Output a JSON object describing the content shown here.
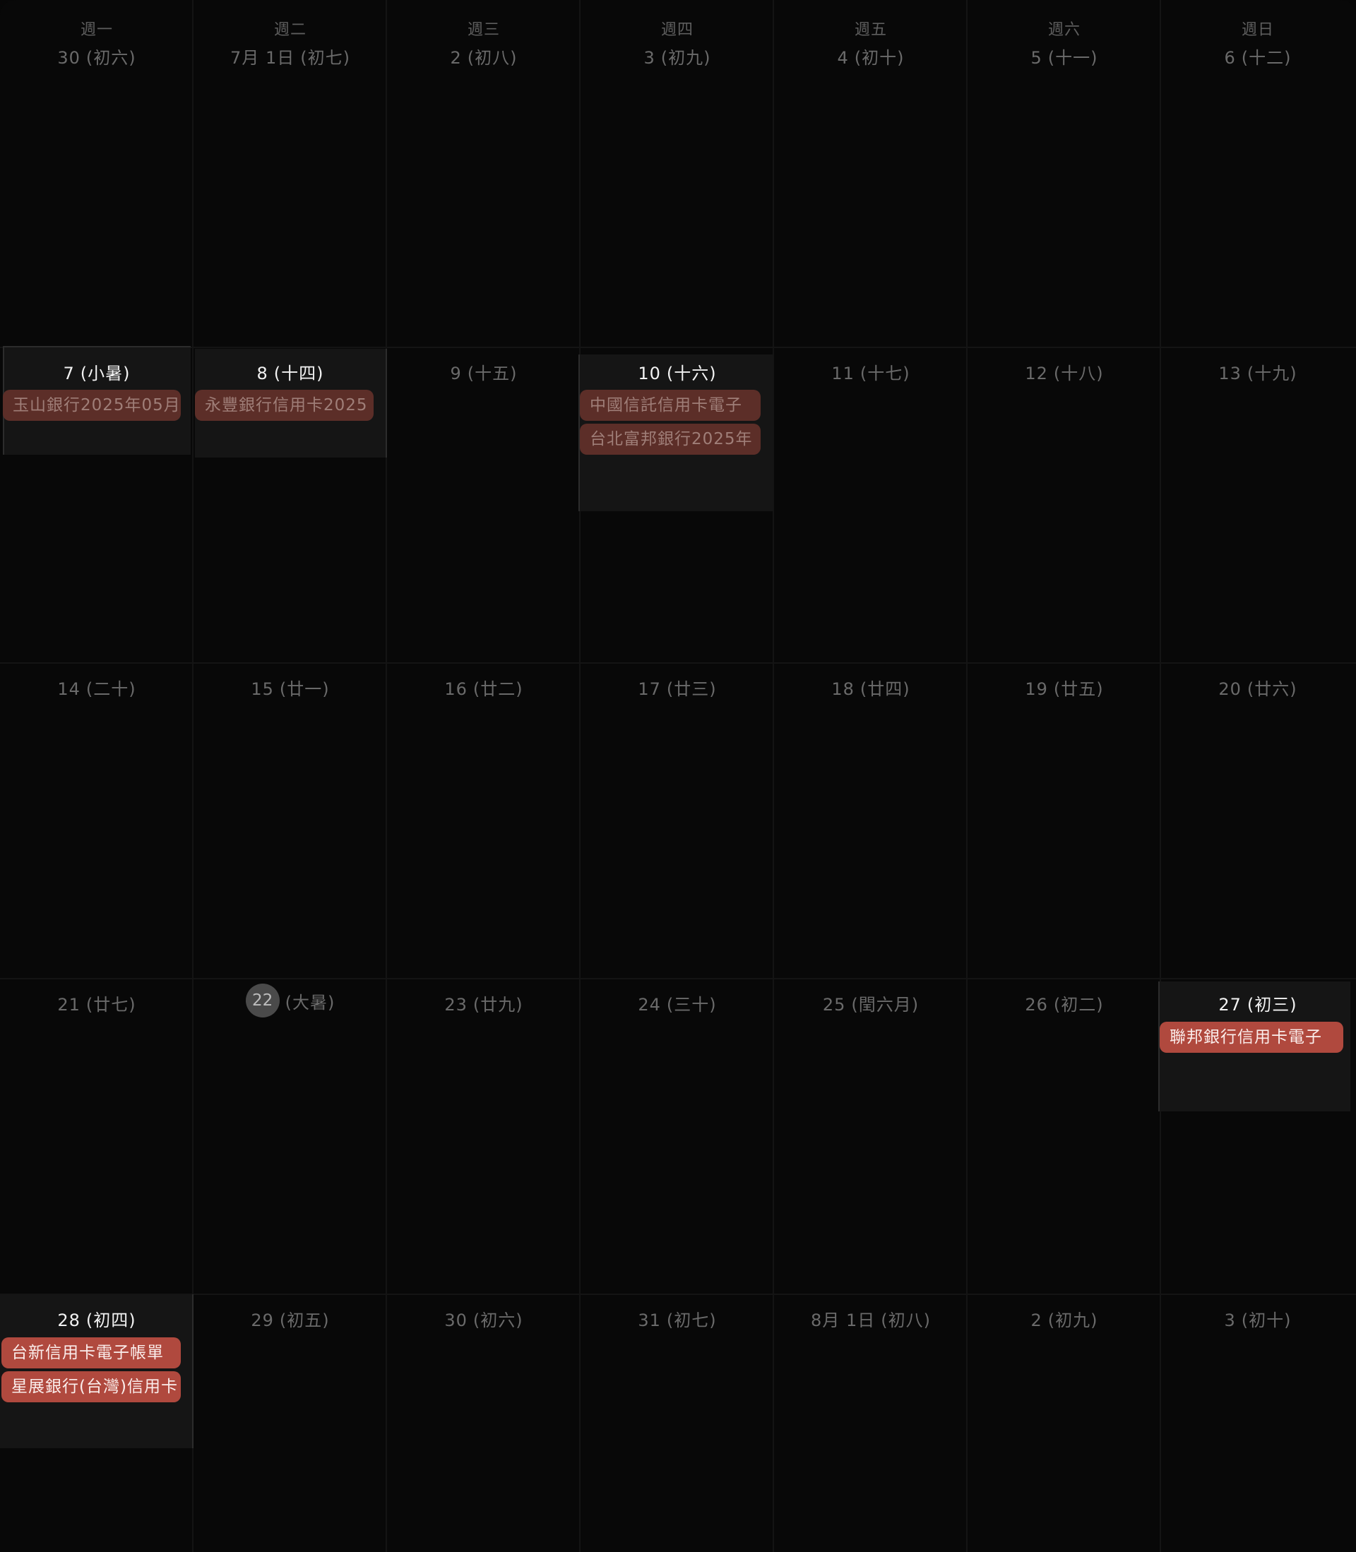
{
  "weekdays": [
    "週一",
    "週二",
    "週三",
    "週四",
    "週五",
    "週六",
    "週日"
  ],
  "weeks": [
    [
      {
        "day": "30",
        "lunar": "(初六)"
      },
      {
        "day": "7月 1日",
        "lunar": "(初七)"
      },
      {
        "day": "2",
        "lunar": "(初八)"
      },
      {
        "day": "3",
        "lunar": "(初九)"
      },
      {
        "day": "4",
        "lunar": "(初十)"
      },
      {
        "day": "5",
        "lunar": "(十一)"
      },
      {
        "day": "6",
        "lunar": "(十二)"
      }
    ],
    [
      {
        "day": "7",
        "lunar": "(小暑)",
        "events": [
          "玉山銀行2025年05月"
        ]
      },
      {
        "day": "8",
        "lunar": "(十四)",
        "events": [
          "永豐銀行信用卡2025"
        ]
      },
      {
        "day": "9",
        "lunar": "(十五)"
      },
      {
        "day": "10",
        "lunar": "(十六)",
        "events": [
          "中國信託信用卡電子",
          "台北富邦銀行2025年"
        ]
      },
      {
        "day": "11",
        "lunar": "(十七)"
      },
      {
        "day": "12",
        "lunar": "(十八)"
      },
      {
        "day": "13",
        "lunar": "(十九)"
      }
    ],
    [
      {
        "day": "14",
        "lunar": "(二十)"
      },
      {
        "day": "15",
        "lunar": "(廿一)"
      },
      {
        "day": "16",
        "lunar": "(廿二)"
      },
      {
        "day": "17",
        "lunar": "(廿三)"
      },
      {
        "day": "18",
        "lunar": "(廿四)"
      },
      {
        "day": "19",
        "lunar": "(廿五)"
      },
      {
        "day": "20",
        "lunar": "(廿六)"
      }
    ],
    [
      {
        "day": "21",
        "lunar": "(廿七)"
      },
      {
        "day": "22",
        "lunar": "(大暑)",
        "today": true
      },
      {
        "day": "23",
        "lunar": "(廿九)"
      },
      {
        "day": "24",
        "lunar": "(三十)"
      },
      {
        "day": "25",
        "lunar": "(閏六月)"
      },
      {
        "day": "26",
        "lunar": "(初二)"
      },
      {
        "day": "27",
        "lunar": "(初三)",
        "events": [
          "聯邦銀行信用卡電子"
        ]
      }
    ],
    [
      {
        "day": "28",
        "lunar": "(初四)",
        "events": [
          "台新信用卡電子帳單",
          "星展銀行(台灣)信用卡"
        ]
      },
      {
        "day": "29",
        "lunar": "(初五)"
      },
      {
        "day": "30",
        "lunar": "(初六)"
      },
      {
        "day": "31",
        "lunar": "(初七)"
      },
      {
        "day": "8月 1日",
        "lunar": "(初八)"
      },
      {
        "day": "2",
        "lunar": "(初九)"
      },
      {
        "day": "3",
        "lunar": "(初十)"
      }
    ]
  ],
  "colors": {
    "background": "#080808",
    "event_past": "#5c2e28",
    "event_upcoming": "#b0493e",
    "today_circle": "#4a4a4a"
  }
}
